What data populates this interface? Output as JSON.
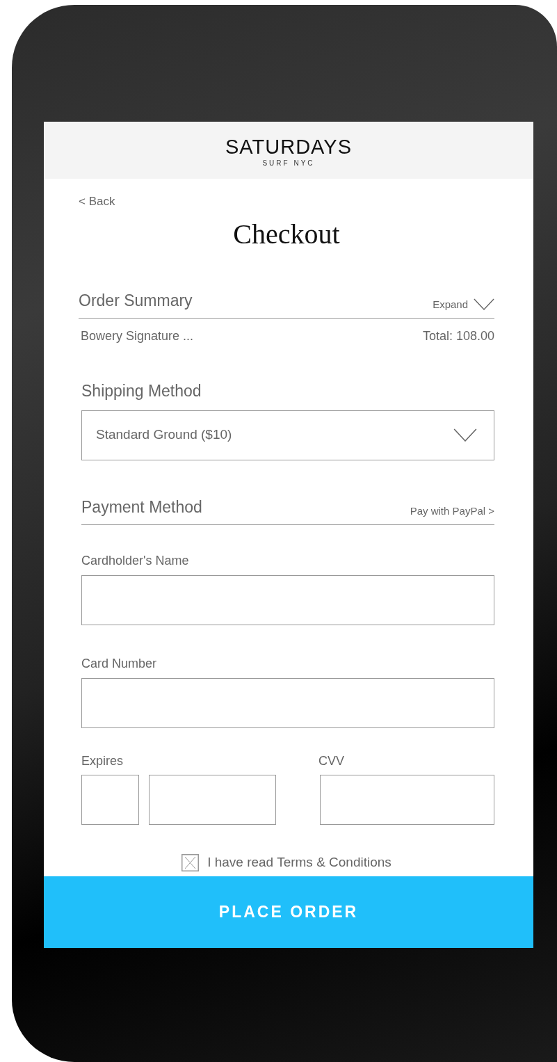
{
  "header": {
    "brand": "SATURDAYS",
    "tagline": "SURF NYC"
  },
  "back_link": "< Back",
  "title": "Checkout",
  "order_summary": {
    "heading": "Order Summary",
    "toggle": "Expand",
    "item": "Bowery Signature ...",
    "total": "Total: 108.00"
  },
  "shipping": {
    "label": "Shipping Method",
    "value": "Standard Ground ($10)"
  },
  "payment": {
    "heading": "Payment Method",
    "alt_link": "Pay with PayPal >"
  },
  "fields": [
    {
      "label": "Cardholder's Name"
    },
    {
      "label": "Card Number"
    }
  ],
  "expires": {
    "label": "Expires"
  },
  "cvv": {
    "label": "CVV"
  },
  "terms": {
    "label": "I have read Terms & Conditions",
    "checked": true
  },
  "submit": "PLACE ORDER"
}
